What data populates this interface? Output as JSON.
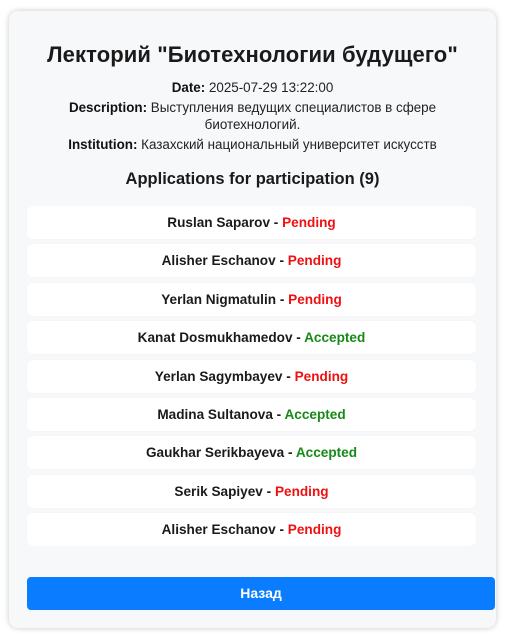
{
  "event": {
    "title": "Лекторий \"Биотехнологии будущего\"",
    "date_label": "Date:",
    "date_value": "2025-07-29 13:22:00",
    "description_label": "Description:",
    "description_value": "Выступления ведущих специалистов в сфере биотехнологий.",
    "institution_label": "Institution:",
    "institution_value": "Казахский национальный университет искусств"
  },
  "applications": {
    "heading": "Applications for participation (9)",
    "separator": " - ",
    "items": [
      {
        "name": "Ruslan Saparov",
        "status": "Pending"
      },
      {
        "name": "Alisher Eschanov",
        "status": "Pending"
      },
      {
        "name": "Yerlan Nigmatulin",
        "status": "Pending"
      },
      {
        "name": "Kanat Dosmukhamedov",
        "status": "Accepted"
      },
      {
        "name": "Yerlan Sagymbayev",
        "status": "Pending"
      },
      {
        "name": "Madina Sultanova",
        "status": "Accepted"
      },
      {
        "name": "Gaukhar Serikbayeva",
        "status": "Accepted"
      },
      {
        "name": "Serik Sapiyev",
        "status": "Pending"
      },
      {
        "name": "Alisher Eschanov",
        "status": "Pending"
      }
    ]
  },
  "actions": {
    "back_label": "Назад"
  },
  "colors": {
    "pending": "#ee1111",
    "accepted": "#168a16",
    "primary_button": "#0a7cff"
  }
}
